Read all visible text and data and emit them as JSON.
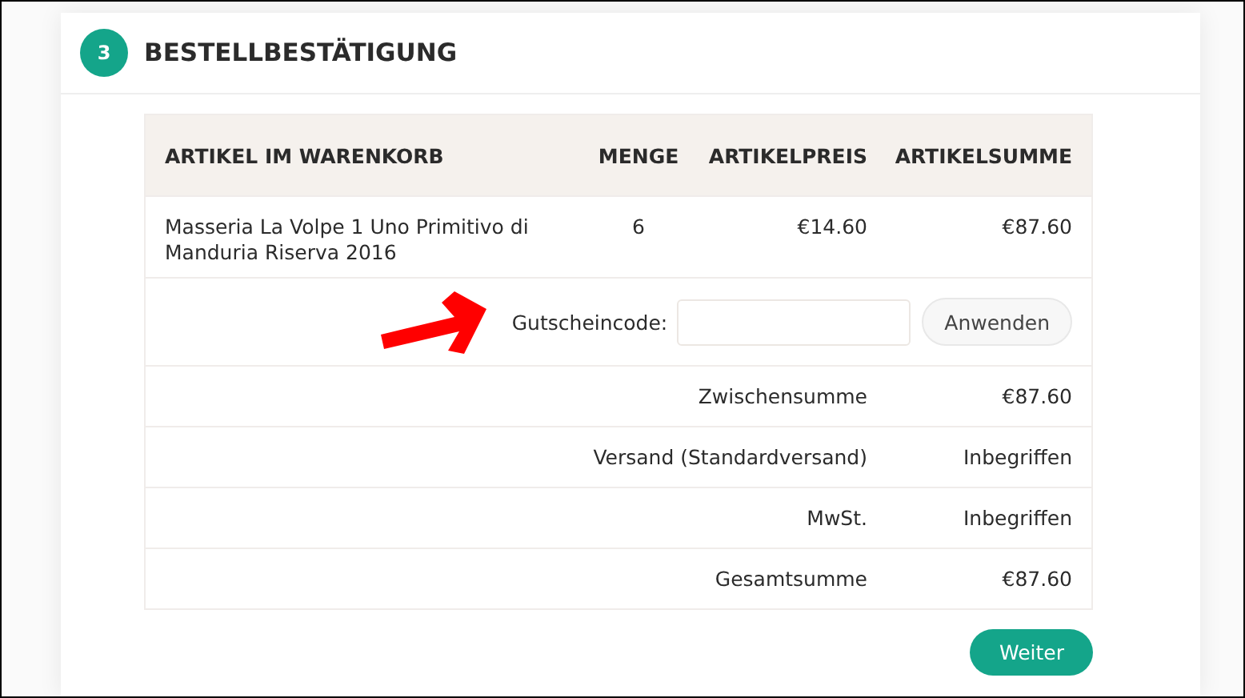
{
  "step": {
    "number": "3",
    "title": "BESTELLBESTÄTIGUNG"
  },
  "table": {
    "columns": [
      "ARTIKEL IM WARENKORB",
      "MENGE",
      "ARTIKELPREIS",
      "ARTIKELSUMME"
    ],
    "rows": [
      {
        "product": "Masseria La Volpe 1 Uno Primitivo di Manduria Riserva 2016",
        "quantity": "6",
        "price": "€14.60",
        "total": "€87.60"
      }
    ]
  },
  "coupon": {
    "label": "Gutscheincode:",
    "button": "Anwenden"
  },
  "summary": [
    {
      "label": "Zwischensumme",
      "value": "€87.60"
    },
    {
      "label": "Versand (Standardversand)",
      "value": "Inbegriffen"
    },
    {
      "label": "MwSt.",
      "value": "Inbegriffen"
    },
    {
      "label": "Gesamtsumme",
      "value": "€87.60"
    }
  ],
  "next_button": "Weiter"
}
